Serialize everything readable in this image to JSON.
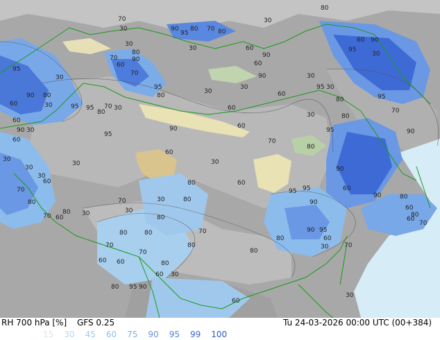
{
  "footer": {
    "product": "RH 700 hPa [%]",
    "model": "GFS 0.25",
    "valid_time": "Tu 24-03-2026 00:00 UTC (00+384)"
  },
  "scale": [
    {
      "label": "15",
      "color": "#c8e8f8"
    },
    {
      "label": "30",
      "color": "#b4d8f0"
    },
    {
      "label": "45",
      "color": "#a0c8e8"
    },
    {
      "label": "60",
      "color": "#8cc0f0"
    },
    {
      "label": "75",
      "color": "#78b0f0"
    },
    {
      "label": "90",
      "color": "#6496e0"
    },
    {
      "label": "95",
      "color": "#507ee0"
    },
    {
      "label": "99",
      "color": "#3c6ad8"
    },
    {
      "label": "100",
      "color": "#2a56c8"
    }
  ],
  "contour_labels": [
    {
      "id": "c1",
      "text": "70"
    },
    {
      "id": "c2",
      "text": "80"
    },
    {
      "id": "c3",
      "text": "30"
    },
    {
      "id": "c4",
      "text": "30"
    },
    {
      "id": "c5",
      "text": "90"
    },
    {
      "id": "c6",
      "text": "80"
    },
    {
      "id": "c7",
      "text": "70"
    },
    {
      "id": "c8",
      "text": "80"
    },
    {
      "id": "c9",
      "text": "95"
    },
    {
      "id": "c10",
      "text": "30"
    },
    {
      "id": "c11",
      "text": "60"
    },
    {
      "id": "c12",
      "text": "90"
    },
    {
      "id": "c13",
      "text": "60"
    },
    {
      "id": "c14",
      "text": "90"
    },
    {
      "id": "c15",
      "text": "95"
    },
    {
      "id": "c16",
      "text": "30"
    },
    {
      "id": "c17",
      "text": "70"
    },
    {
      "id": "c18",
      "text": "80"
    },
    {
      "id": "c19",
      "text": "90"
    },
    {
      "id": "c20",
      "text": "60"
    },
    {
      "id": "c21",
      "text": "95"
    },
    {
      "id": "c22",
      "text": "30"
    },
    {
      "id": "c23",
      "text": "70"
    },
    {
      "id": "c24",
      "text": "60"
    },
    {
      "id": "c25",
      "text": "30"
    },
    {
      "id": "c26",
      "text": "90"
    },
    {
      "id": "c27",
      "text": "95"
    },
    {
      "id": "c28",
      "text": "30"
    },
    {
      "id": "c29",
      "text": "95"
    },
    {
      "id": "c30",
      "text": "80"
    },
    {
      "id": "c31",
      "text": "60"
    },
    {
      "id": "c32",
      "text": "60"
    },
    {
      "id": "c33",
      "text": "30"
    },
    {
      "id": "c34",
      "text": "30"
    },
    {
      "id": "c35",
      "text": "95"
    },
    {
      "id": "c36",
      "text": "90"
    },
    {
      "id": "c37",
      "text": "80"
    },
    {
      "id": "c38",
      "text": "60"
    },
    {
      "id": "c39",
      "text": "30"
    },
    {
      "id": "c40",
      "text": "30"
    },
    {
      "id": "c41",
      "text": "80"
    },
    {
      "id": "c42",
      "text": "95"
    },
    {
      "id": "c43",
      "text": "95"
    },
    {
      "id": "c44",
      "text": "80"
    },
    {
      "id": "c45",
      "text": "70"
    },
    {
      "id": "c46",
      "text": "30"
    },
    {
      "id": "c47",
      "text": "30"
    },
    {
      "id": "c48",
      "text": "80"
    },
    {
      "id": "c49",
      "text": "70"
    },
    {
      "id": "c50",
      "text": "60"
    },
    {
      "id": "c51",
      "text": "30"
    },
    {
      "id": "c52",
      "text": "90"
    },
    {
      "id": "c53",
      "text": "95"
    },
    {
      "id": "c54",
      "text": "90"
    },
    {
      "id": "c55",
      "text": "60"
    },
    {
      "id": "c56",
      "text": "95"
    },
    {
      "id": "c57",
      "text": "90"
    },
    {
      "id": "c58",
      "text": "60"
    },
    {
      "id": "c59",
      "text": "70"
    },
    {
      "id": "c60",
      "text": "80"
    },
    {
      "id": "c61",
      "text": "30"
    },
    {
      "id": "c62",
      "text": "30"
    },
    {
      "id": "c63",
      "text": "30"
    },
    {
      "id": "c64",
      "text": "30"
    },
    {
      "id": "c65",
      "text": "60"
    },
    {
      "id": "c66",
      "text": "30"
    },
    {
      "id": "c67",
      "text": "90"
    },
    {
      "id": "c68",
      "text": "60"
    },
    {
      "id": "c69",
      "text": "70"
    },
    {
      "id": "c70",
      "text": "80"
    },
    {
      "id": "c71",
      "text": "95"
    },
    {
      "id": "c72",
      "text": "60"
    },
    {
      "id": "c73",
      "text": "80"
    },
    {
      "id": "c74",
      "text": "60"
    },
    {
      "id": "c75",
      "text": "95"
    },
    {
      "id": "c76",
      "text": "90"
    },
    {
      "id": "c77",
      "text": "80"
    },
    {
      "id": "c78",
      "text": "70"
    },
    {
      "id": "c79",
      "text": "60"
    },
    {
      "id": "c80",
      "text": "80"
    },
    {
      "id": "c81",
      "text": "30"
    },
    {
      "id": "c82",
      "text": "70"
    },
    {
      "id": "c83",
      "text": "30"
    },
    {
      "id": "c84",
      "text": "80"
    },
    {
      "id": "c85",
      "text": "90"
    },
    {
      "id": "c86",
      "text": "60"
    },
    {
      "id": "c87",
      "text": "80"
    },
    {
      "id": "c88",
      "text": "60"
    },
    {
      "id": "c89",
      "text": "70"
    },
    {
      "id": "c90",
      "text": "80"
    },
    {
      "id": "c91",
      "text": "30"
    },
    {
      "id": "c92",
      "text": "80"
    },
    {
      "id": "c93",
      "text": "70"
    },
    {
      "id": "c94",
      "text": "80"
    },
    {
      "id": "c95",
      "text": "90"
    },
    {
      "id": "c96",
      "text": "95"
    },
    {
      "id": "c97",
      "text": "80"
    },
    {
      "id": "c98",
      "text": "60"
    },
    {
      "id": "c99",
      "text": "30"
    },
    {
      "id": "c100",
      "text": "70"
    },
    {
      "id": "c101",
      "text": "80"
    },
    {
      "id": "c102",
      "text": "70"
    },
    {
      "id": "c103",
      "text": "80"
    },
    {
      "id": "c104",
      "text": "60"
    },
    {
      "id": "c105",
      "text": "60"
    },
    {
      "id": "c106",
      "text": "80"
    },
    {
      "id": "c107",
      "text": "60"
    },
    {
      "id": "c108",
      "text": "30"
    },
    {
      "id": "c109",
      "text": "80"
    },
    {
      "id": "c110",
      "text": "95"
    },
    {
      "id": "c111",
      "text": "90"
    },
    {
      "id": "c112",
      "text": "70"
    },
    {
      "id": "c113",
      "text": "60"
    },
    {
      "id": "c114",
      "text": "30"
    }
  ]
}
